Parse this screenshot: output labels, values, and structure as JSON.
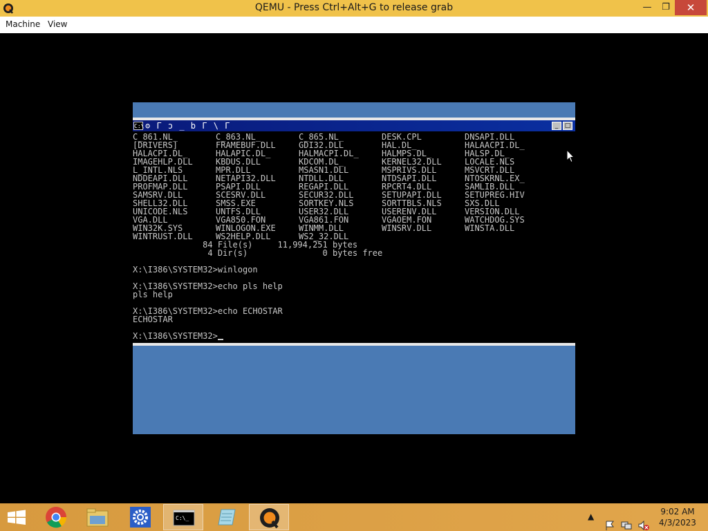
{
  "window": {
    "title": "QEMU - Press Ctrl+Alt+G to release grab",
    "minimize_glyph": "—",
    "maximize_glyph": "❐",
    "close_glyph": "✕"
  },
  "menu": {
    "items": [
      {
        "label": "Machine"
      },
      {
        "label": "View"
      }
    ]
  },
  "console": {
    "title_icon": "C:\\",
    "title_text": "ʘ Γ ɔ _ b Γ \\ Γ",
    "file_grid": [
      [
        "C_861.NL_",
        "C_863.NL_",
        "C_865.NL_",
        "DESK.CPL",
        "DNSAPI.DLL"
      ],
      [
        "[DRIVERS]",
        "FRAMEBUF.DLL",
        "GDI32.DLL",
        "HAL.DL_",
        "HALAACPI.DL_"
      ],
      [
        "HALACPI.DL_",
        "HALAPIC.DL_",
        "HALMACPI.DL_",
        "HALMPS.DL_",
        "HALSP.DL_"
      ],
      [
        "IMAGEHLP.DLL",
        "KBDUS.DLL",
        "KDCOM.DL_",
        "KERNEL32.DLL",
        "LOCALE.NLS"
      ],
      [
        "L_INTL.NLS",
        "MPR.DLL",
        "MSASN1.DLL",
        "MSPRIVS.DLL",
        "MSVCRT.DLL"
      ],
      [
        "NDDEAPI.DLL",
        "NETAPI32.DLL",
        "NTDLL.DLL",
        "NTDSAPI.DLL",
        "NTOSKRNL.EX_"
      ],
      [
        "PROFMAP.DLL",
        "PSAPI.DLL",
        "REGAPI.DLL",
        "RPCRT4.DLL",
        "SAMLIB.DLL"
      ],
      [
        "SAMSRV.DLL",
        "SCESRV.DLL",
        "SECUR32.DLL",
        "SETUPAPI.DLL",
        "SETUPREG.HIV"
      ],
      [
        "SHELL32.DLL",
        "SMSS.EXE",
        "SORTKEY.NLS",
        "SORTTBLS.NLS",
        "SXS.DLL"
      ],
      [
        "UNICODE.NLS",
        "UNTFS.DLL",
        "USER32.DLL",
        "USERENV.DLL",
        "VERSION.DLL"
      ],
      [
        "VGA.DLL",
        "VGA850.FON",
        "VGA861.FON",
        "VGAOEM.FON",
        "WATCHDOG.SYS"
      ],
      [
        "WIN32K.SYS",
        "WINLOGON.EXE",
        "WINMM.DLL",
        "WINSRV.DLL",
        "WINSTA.DLL"
      ],
      [
        "WINTRUST.DLL",
        "WS2HELP.DLL",
        "WS2_32.DLL",
        "",
        ""
      ]
    ],
    "summary": [
      "              84 File(s)     11,994,251 bytes",
      "               4 Dir(s)               0 bytes free"
    ],
    "history": [
      "",
      "X:\\I386\\SYSTEM32>winlogon",
      "",
      "X:\\I386\\SYSTEM32>echo pls help",
      "pls help",
      "",
      "X:\\I386\\SYSTEM32>echo ECHOSTAR",
      "ECHOSTAR",
      ""
    ],
    "prompt": "X:\\I386\\SYSTEM32>"
  },
  "taskbar": {
    "apps": [
      {
        "name": "start-button",
        "icon": "windows-logo-icon"
      },
      {
        "name": "chrome",
        "icon": "chrome-icon"
      },
      {
        "name": "file-explorer",
        "icon": "folder-icon"
      },
      {
        "name": "settings",
        "icon": "gear-icon"
      },
      {
        "name": "command-prompt",
        "icon": "cmd-icon",
        "label": "C:\\_"
      },
      {
        "name": "notepad",
        "icon": "notepad-icon"
      },
      {
        "name": "qemu",
        "icon": "qemu-icon"
      }
    ],
    "clock": {
      "time": "9:02 AM",
      "date": "4/3/2023"
    }
  },
  "colors": {
    "titlebar": "#f0c24a",
    "close_button": "#c7483a",
    "guest_desktop": "#4a7ab4",
    "console_text": "#c8c8c8",
    "console_titlebar": "#0a1a7a",
    "taskbar": "#d79a3f"
  }
}
